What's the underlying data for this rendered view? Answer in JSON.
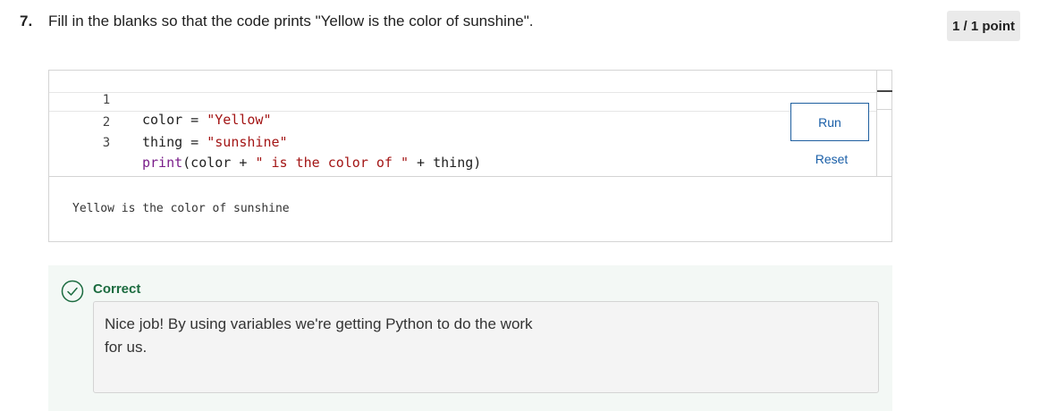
{
  "question": {
    "number": "7.",
    "prompt": "Fill in the blanks so that the code prints \"Yellow is the color of sunshine\".",
    "score": "1 / 1 point"
  },
  "editor": {
    "lines": [
      {
        "num": "1",
        "tokens": {
          "a": "color = ",
          "b": "\"Yellow\""
        }
      },
      {
        "num": "2",
        "tokens": {
          "a": "thing = ",
          "b": "\"sunshine\""
        }
      },
      {
        "num": "3",
        "tokens": {
          "a": "print",
          "b": "(color + ",
          "c": "\" is the color of \"",
          "d": " + thing)"
        }
      }
    ],
    "run_label": "Run",
    "reset_label": "Reset"
  },
  "output": {
    "text": "Yellow is the color of sunshine"
  },
  "feedback": {
    "status": "Correct",
    "message": "Nice job! By using variables we're getting Python to do the work for us."
  },
  "colors": {
    "string": "#a31515",
    "keyword": "#7a1e8a",
    "link": "#1a5fa8",
    "correct": "#1b6b3f",
    "feedback_bg": "#f3f8f5"
  }
}
